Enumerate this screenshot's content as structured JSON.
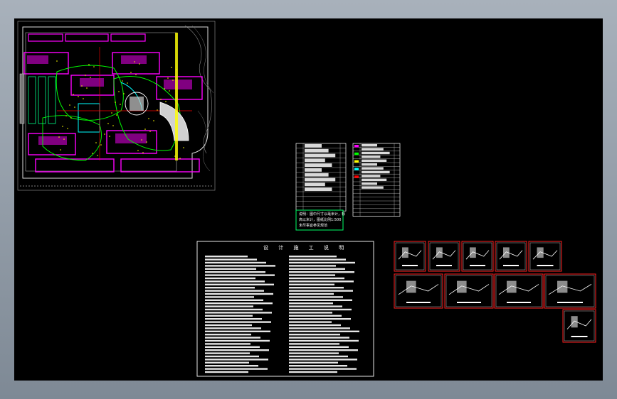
{
  "app": {
    "background_color": "#000000",
    "chrome_color": "#8f9aa6"
  },
  "drawing": {
    "site_plan": {
      "colors": {
        "building": "#ff00ff",
        "road": "#ffffff",
        "green": "#00ff00",
        "water": "#00ffff",
        "hatch": "#ffff00",
        "path": "#ff0000"
      }
    },
    "legend_tables": {
      "left_rows": 14,
      "right_rows": 19
    },
    "note_box": {
      "lines": [
        "说明：图中尺寸以毫米计，标",
        "高以米计，图纸比例1:500",
        "未尽事宜参见规范"
      ],
      "border_color": "#00ff66"
    },
    "design_notes": {
      "title": "设 计 施 工 说 明"
    },
    "detail_sheets": {
      "border_color": "#ff2020",
      "count": 11
    }
  }
}
